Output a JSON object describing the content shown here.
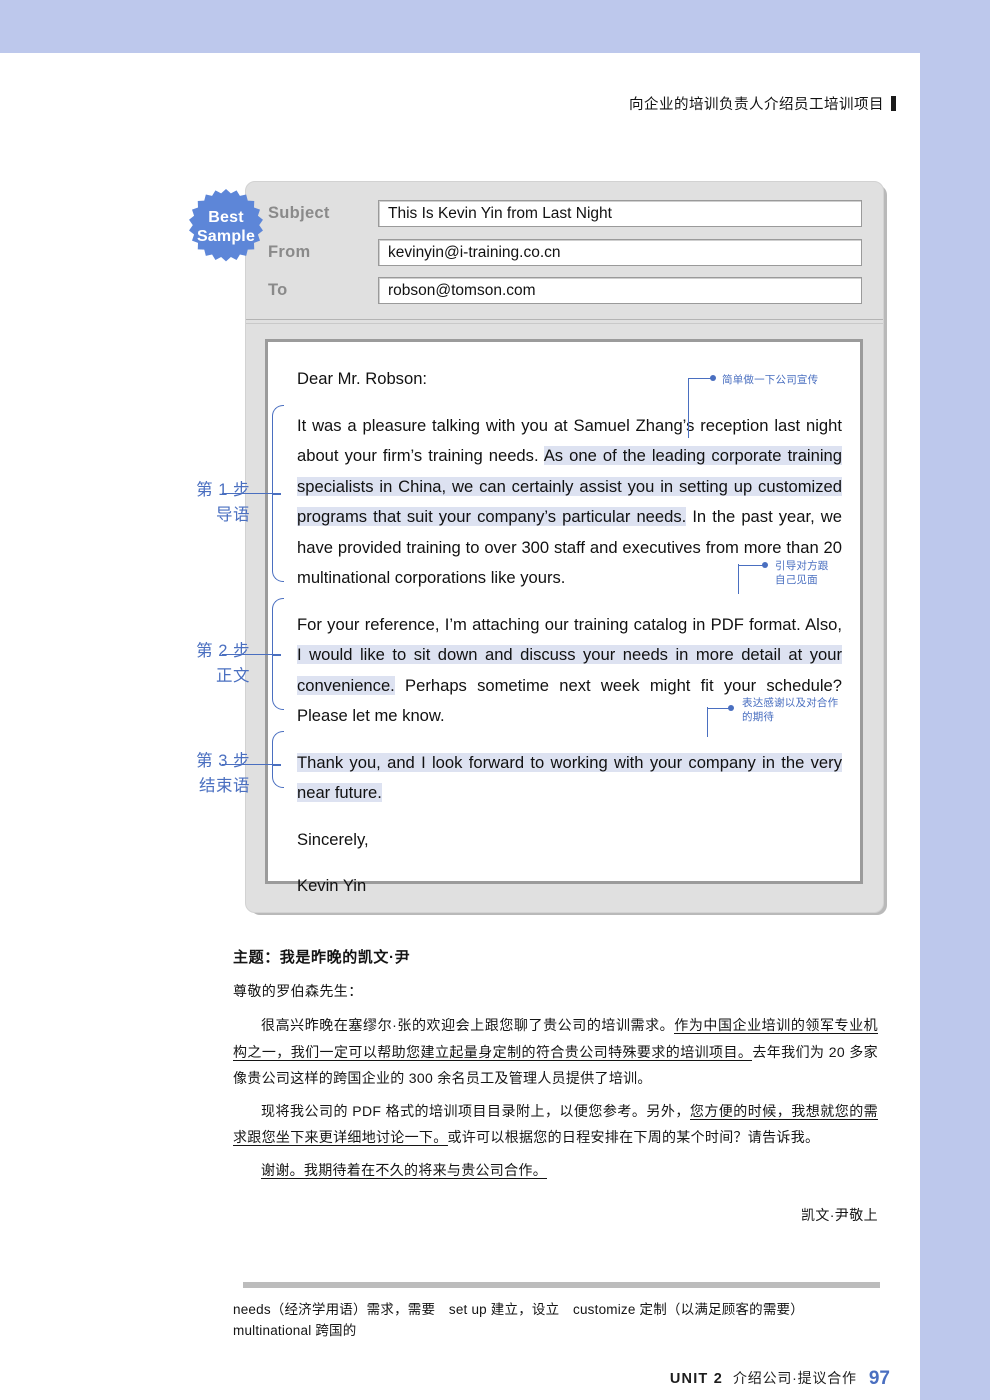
{
  "running_head": "向企业的培训负责人介绍员工培训项目",
  "badge": {
    "line1": "Best",
    "line2": "Sample",
    "color": "#5d86d8"
  },
  "email": {
    "fields": [
      {
        "label": "Subject",
        "value": "This Is Kevin Yin from Last Night"
      },
      {
        "label": "From",
        "value": "kevinyin@i-training.co.cn"
      },
      {
        "label": "To",
        "value": "robson@tomson.com"
      }
    ],
    "salutation": "Dear Mr. Robson:",
    "p1_a": "It was a pleasure talking with you at Samuel Zhang’s reception last night about your firm’s training needs. ",
    "p1_hl": "As one of the leading corporate training specialists in China, we can certainly assist you in setting up customized programs that suit your company’s particular needs.",
    "p1_b": " In the past year, we have provided training to over 300 staff and executives from more than 20 multinational corporations like yours.",
    "p2_a": "For your reference, I’m attaching our training catalog in PDF format. Also, ",
    "p2_hl": "I would like to sit down and discuss your needs in more detail at your convenience.",
    "p2_b": " Perhaps sometime next week might fit your schedule? Please let me know.",
    "p3_hl": "Thank you, and I look forward to working with your company in the very near future.",
    "closing": "Sincerely,",
    "signature": "Kevin Yin"
  },
  "steps": [
    {
      "num": "第 1 步",
      "name": "导语"
    },
    {
      "num": "第 2 步",
      "name": "正文"
    },
    {
      "num": "第 3 步",
      "name": "结束语"
    }
  ],
  "callouts": [
    {
      "text": "简单做一下公司宣传"
    },
    {
      "text": "引导对方跟\n自己见面"
    },
    {
      "text": "表达感谢以及对合作\n的期待"
    }
  ],
  "translation": {
    "title": "主题：我是昨晚的凯文·尹",
    "salutation": "尊敬的罗伯森先生：",
    "p1_a": "很高兴昨晚在塞缪尔·张的欢迎会上跟您聊了贵公司的培训需求。",
    "p1_u": "作为中国企业培训的领军专业机构之一，我们一定可以帮助您建立起量身定制的符合贵公司特殊要求的培训项目。",
    "p1_b": "去年我们为 20 多家像贵公司这样的跨国企业的 300 余名员工及管理人员提供了培训。",
    "p2_a": "现将我公司的 PDF 格式的培训项目目录附上，以便您参考。另外，",
    "p2_u": "您方便的时候，我想就您的需求跟您坐下来更详细地讨论一下。",
    "p2_b": "或许可以根据您的日程安排在下周的某个时间？请告诉我。",
    "p3_u": "谢谢。我期待着在不久的将来与贵公司合作。",
    "signoff": "凯文·尹敬上"
  },
  "vocabulary": {
    "line1": "needs（经济学用语）需求，需要　set up 建立，设立　customize 定制（以满足顾客的需要）",
    "line2": "multinational 跨国的"
  },
  "footer": {
    "unit": "UNIT 2",
    "topic": "介绍公司·提议合作",
    "page": "97"
  }
}
